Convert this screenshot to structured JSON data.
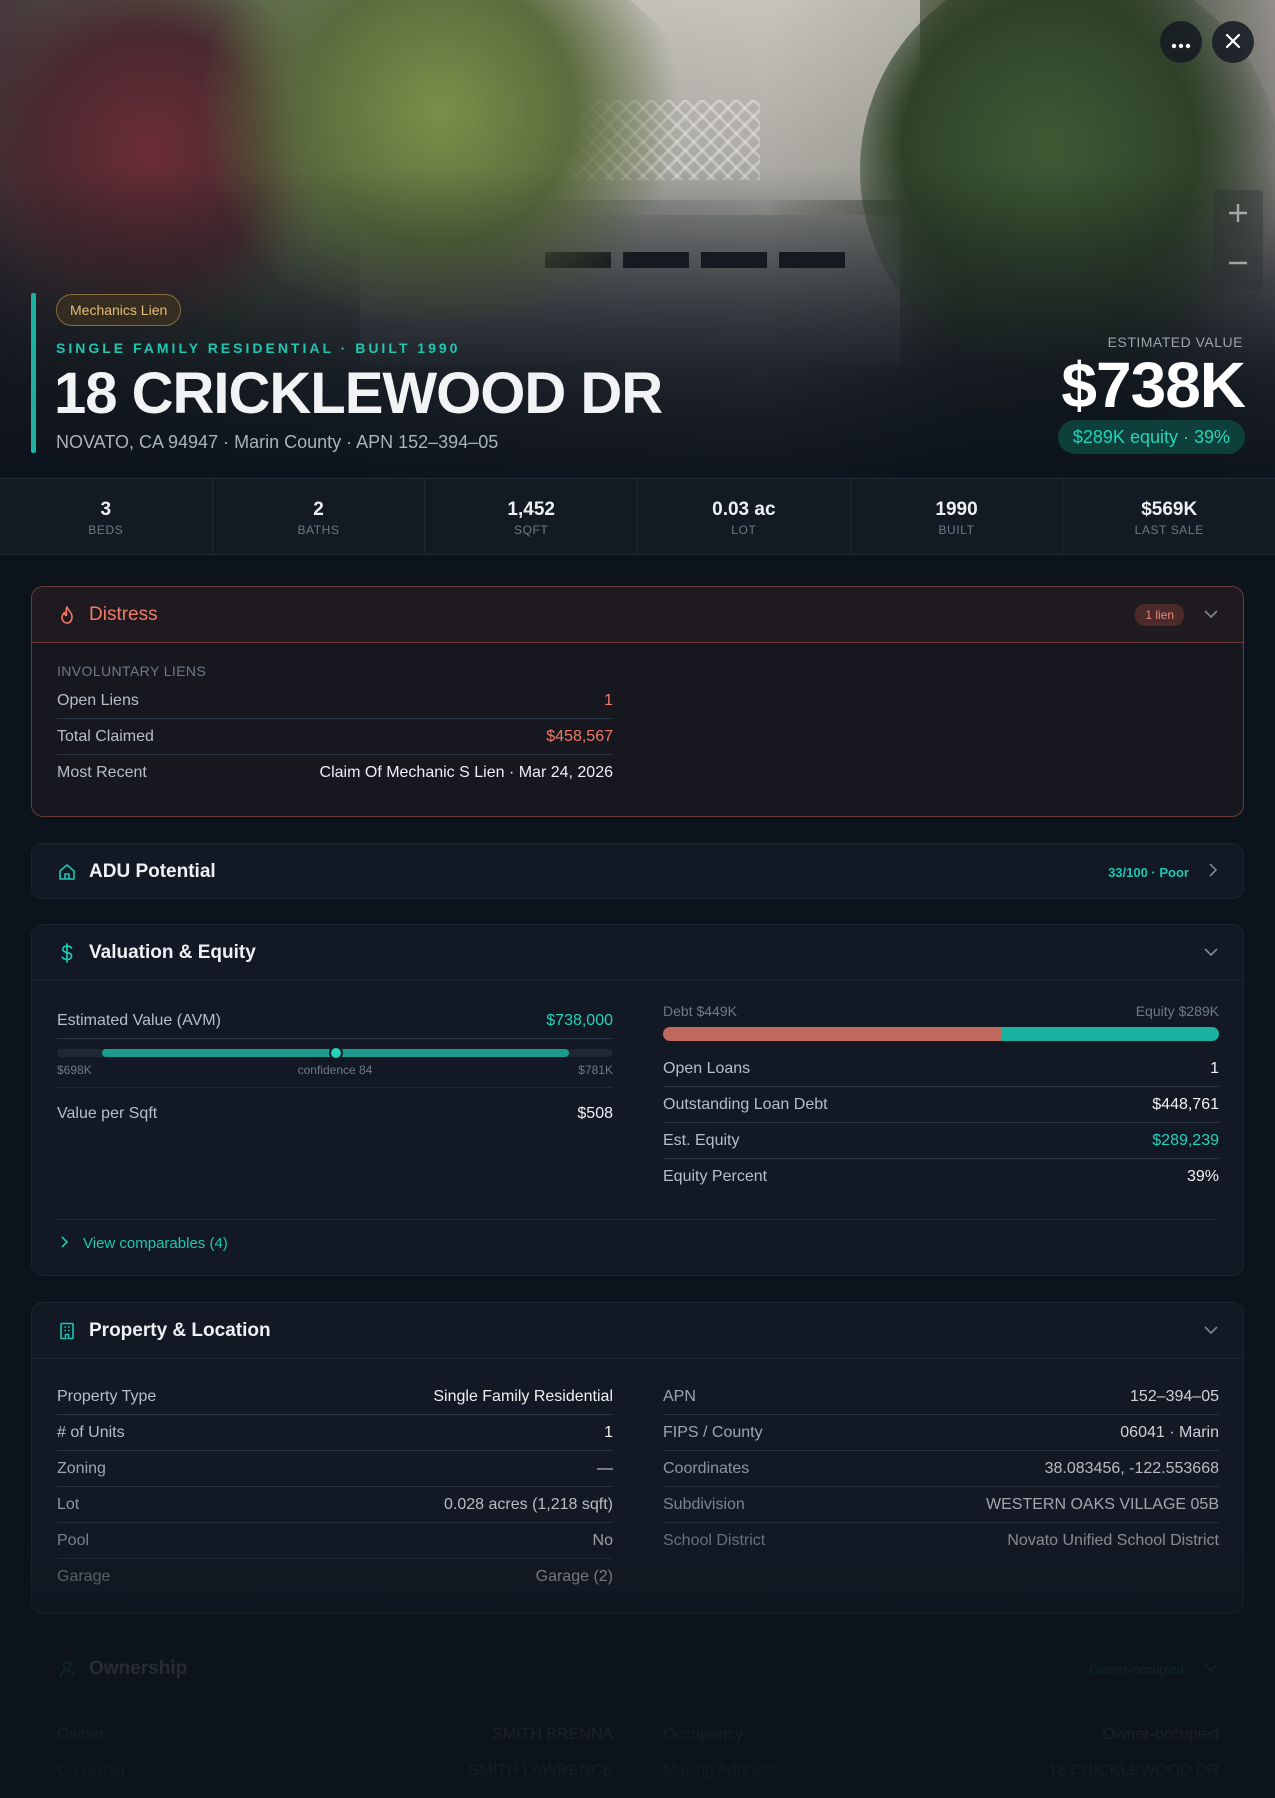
{
  "hero": {
    "badge": "Mechanics Lien",
    "kicker": "SINGLE FAMILY RESIDENTIAL · BUILT 1990",
    "title": "18 CRICKLEWOOD DR",
    "subtitle": "NOVATO, CA 94947 · Marin County · APN 152–394–05",
    "estimated_label": "ESTIMATED VALUE",
    "estimated_value": "$738K",
    "equity_pill": "$289K equity · 39%",
    "more_icon": "more-horizontal-icon",
    "close_icon": "close-icon",
    "zoom_in_icon": "plus-icon",
    "zoom_out_icon": "minus-icon"
  },
  "stats": [
    {
      "value": "3",
      "label": "BEDS"
    },
    {
      "value": "2",
      "label": "BATHS"
    },
    {
      "value": "1,452",
      "label": "SQFT"
    },
    {
      "value": "0.03 ac",
      "label": "LOT"
    },
    {
      "value": "1990",
      "label": "BUILT"
    },
    {
      "value": "$569K",
      "label": "LAST SALE"
    }
  ],
  "distress": {
    "title": "Distress",
    "chip": "1 lien",
    "section_label": "INVOLUNTARY LIENS",
    "rows": [
      {
        "label": "Open Liens",
        "value": "1"
      },
      {
        "label": "Total Claimed",
        "value": "$458,567"
      },
      {
        "label": "Most Recent",
        "value": "Claim Of Mechanic S Lien · Mar 24, 2026"
      }
    ]
  },
  "adu": {
    "title": "ADU Potential",
    "score": "33/100 · Poor"
  },
  "valuation": {
    "title": "Valuation & Equity",
    "avm_label": "Estimated Value (AVM)",
    "avm_value": "$738,000",
    "range_low": "$698K",
    "range_mid": "confidence 84",
    "range_high": "$781K",
    "confidence": 84,
    "per_sqft_label": "Value per Sqft",
    "per_sqft_value": "$508",
    "debt_label": "Debt $449K",
    "equity_label": "Equity $289K",
    "debt_fraction": 0.61,
    "rows": [
      {
        "label": "Open Loans",
        "value": "1"
      },
      {
        "label": "Outstanding Loan Debt",
        "value": "$448,761"
      },
      {
        "label": "Est. Equity",
        "value": "$289,239"
      },
      {
        "label": "Equity Percent",
        "value": "39%"
      }
    ],
    "comparables_link": "View comparables (4)"
  },
  "property": {
    "title": "Property & Location",
    "left_rows": [
      {
        "label": "Property Type",
        "value": "Single Family Residential"
      },
      {
        "label": "# of Units",
        "value": "1"
      },
      {
        "label": "Zoning",
        "value": "—"
      },
      {
        "label": "Lot",
        "value": "0.028 acres (1,218 sqft)"
      },
      {
        "label": "Pool",
        "value": "No"
      },
      {
        "label": "Garage",
        "value": "Garage (2)"
      }
    ],
    "right_rows": [
      {
        "label": "APN",
        "value": "152–394–05"
      },
      {
        "label": "FIPS / County",
        "value": "06041 · Marin"
      },
      {
        "label": "Coordinates",
        "value": "38.083456, -122.553668"
      },
      {
        "label": "Subdivision",
        "value": "WESTERN OAKS VILLAGE 05B"
      },
      {
        "label": "School District",
        "value": "Novato Unified School District"
      }
    ]
  },
  "ownership": {
    "title": "Ownership",
    "chip": "Owner-occupied",
    "left_rows": [
      {
        "label": "Owner",
        "value": "SMITH BRENNA"
      },
      {
        "label": "Co-owner",
        "value": "SMITH LAWRENCE"
      }
    ],
    "right_rows": [
      {
        "label": "Occupancy",
        "value": "Owner-occupied"
      },
      {
        "label": "Mailing Address",
        "value": "18 CRICKLEWOOD DR"
      }
    ]
  },
  "colors": {
    "accent_teal": "#1ec7b2",
    "distress_red": "#ef7a68",
    "background": "#0d131c"
  }
}
